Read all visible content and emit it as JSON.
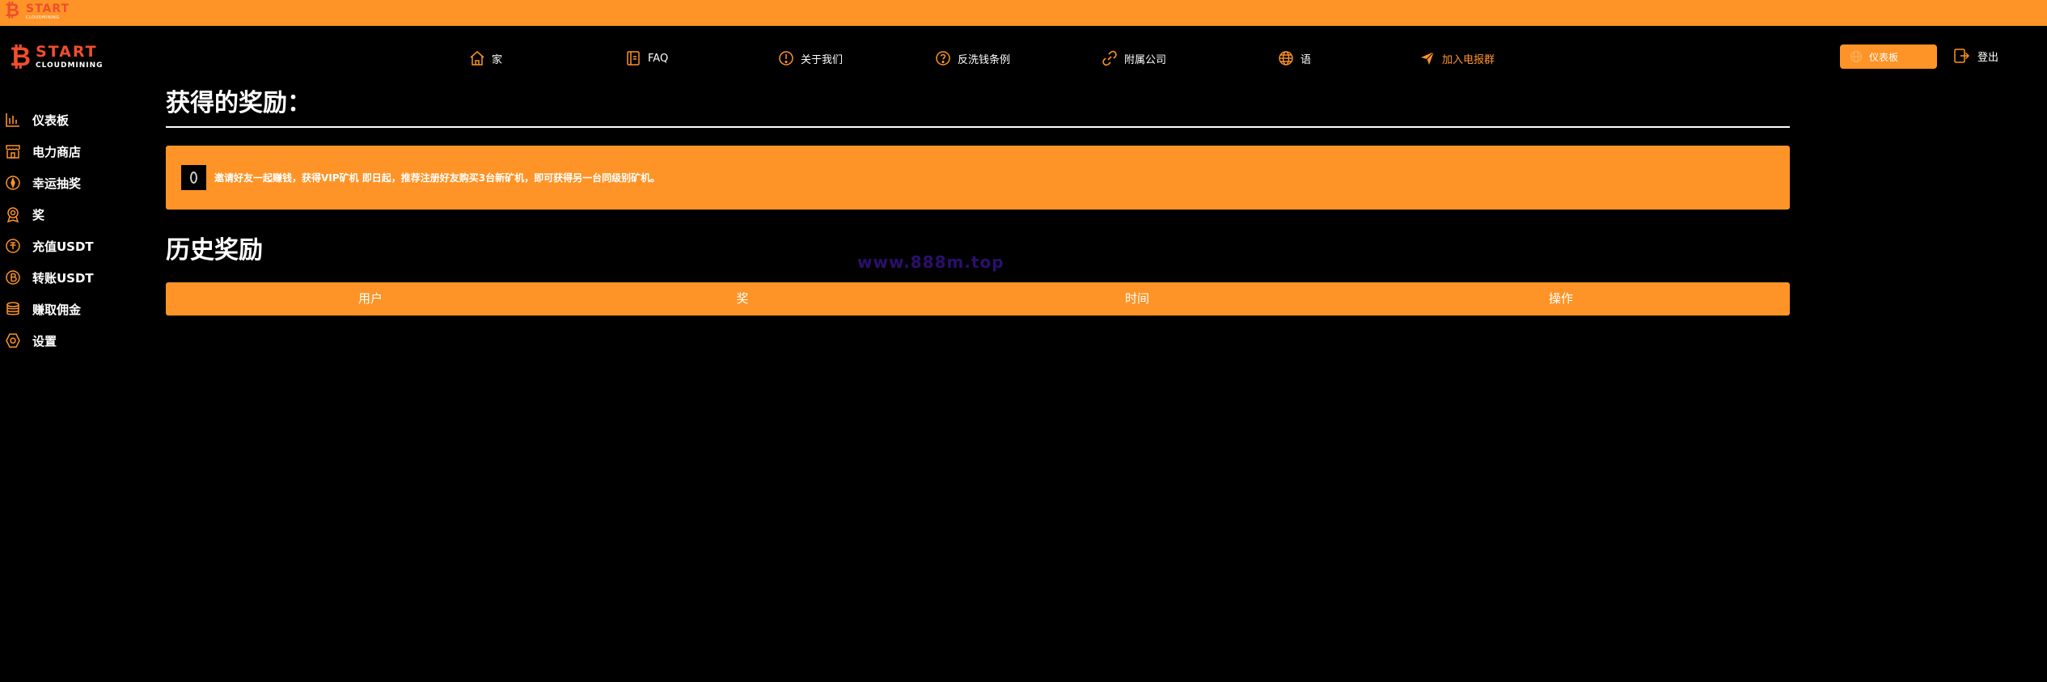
{
  "topbar": {
    "logo_main": "START",
    "logo_sub": "CLOUDMINING",
    "coin_symbol": "₿"
  },
  "brand": {
    "logo_main": "START",
    "logo_sub": "CLOUDMINING",
    "coin_symbol": "₿"
  },
  "nav": {
    "home": "家",
    "faq": "FAQ",
    "about": "关于我们",
    "aml": "反洗钱条例",
    "affiliate": "附属公司",
    "language": "语",
    "telegram": "加入电报群"
  },
  "header_actions": {
    "dashboard": "仪表板",
    "logout": "登出"
  },
  "sidebar": {
    "items": [
      {
        "label": "仪表板",
        "icon": "bar-chart-icon"
      },
      {
        "label": "电力商店",
        "icon": "store-icon"
      },
      {
        "label": "幸运抽奖",
        "icon": "lucky-draw-icon"
      },
      {
        "label": "奖",
        "icon": "award-icon"
      },
      {
        "label": "充值USDT",
        "icon": "deposit-icon"
      },
      {
        "label": "转账USDT",
        "icon": "bitcoin-icon"
      },
      {
        "label": "赚取佣金",
        "icon": "database-icon"
      },
      {
        "label": "设置",
        "icon": "settings-icon"
      }
    ]
  },
  "main": {
    "title": "获得的奖励：",
    "notice": "邀请好友一起赚钱，获得VIP矿机 即日起，推荐注册好友购买3台新矿机，即可获得另一台同级别矿机。",
    "history_title": "历史奖励",
    "table_headers": [
      "用户",
      "奖",
      "时间",
      "操作"
    ]
  },
  "watermark": "www.888m.top",
  "colors": {
    "accent": "#fe9427",
    "brand": "#f04e2c",
    "background": "#000000",
    "watermark": "#2b0f6b"
  }
}
